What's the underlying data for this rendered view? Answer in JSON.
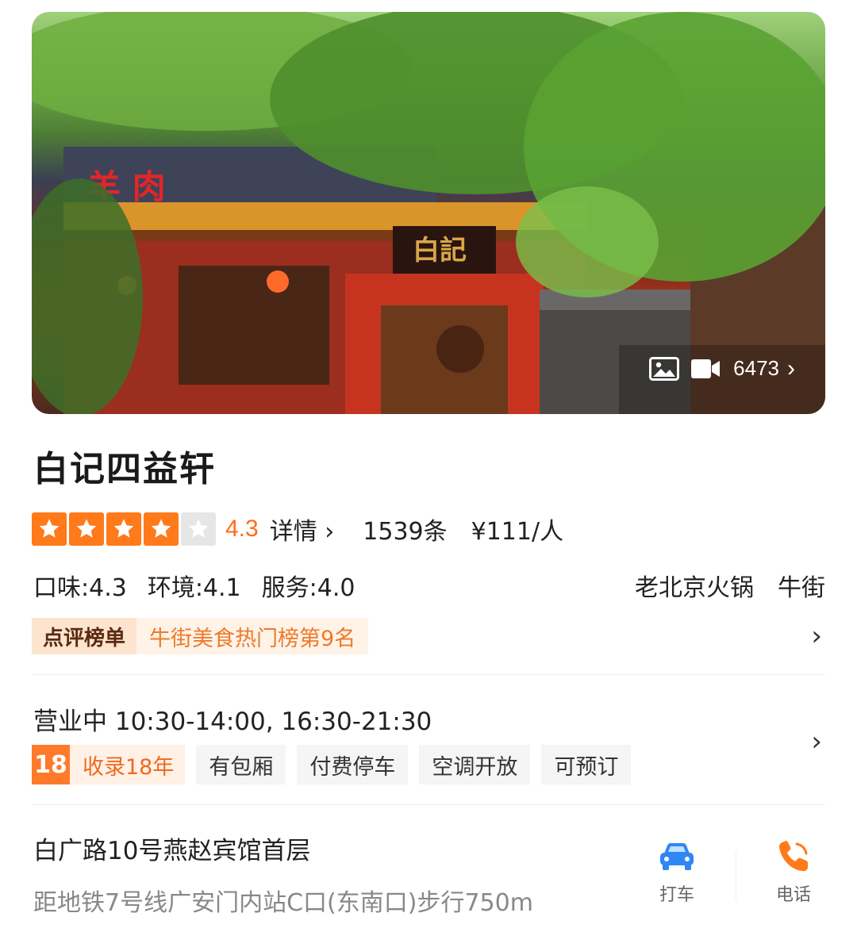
{
  "hero": {
    "media_count": "6473",
    "photo_icon": "image-icon",
    "video_icon": "video-icon",
    "sign_text": "白記",
    "sign_left": "羊 肉"
  },
  "restaurant": {
    "name": "白记四益轩",
    "rating": {
      "stars_filled": 4,
      "stars_total": 5,
      "score": "4.3"
    },
    "detail_label": "详情",
    "review_count": "1539条",
    "price_per_person": "¥111/人",
    "sub_scores": [
      "口味:4.3",
      "环境:4.1",
      "服务:4.0"
    ],
    "categories": [
      "老北京火锅",
      "牛街"
    ]
  },
  "ranking": {
    "tag": "点评榜单",
    "text": "牛街美食热门榜第9名"
  },
  "hours": {
    "text": "营业中 10:30-14:00, 16:30-21:30"
  },
  "tags": {
    "years_number": "18",
    "years_label": "收录18年",
    "items": [
      "有包厢",
      "付费停车",
      "空调开放",
      "可预订"
    ]
  },
  "address": {
    "street": "白广路10号燕赵宾馆首层",
    "distance": "距地铁7号线广安门内站C口(东南口)步行750m"
  },
  "actions": {
    "taxi_label": "打车",
    "phone_label": "电话"
  },
  "colors": {
    "accent": "#ff7a1a",
    "taxi_blue": "#2f86f6"
  }
}
